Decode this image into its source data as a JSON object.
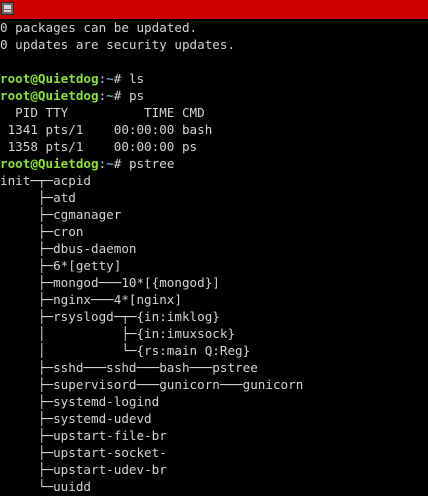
{
  "colors": {
    "titlebar": "#cc0000",
    "background": "#000000",
    "text": "#d3d3d3",
    "prompt_user": "#8ae234",
    "prompt_path": "#729fcf"
  },
  "icons": {
    "window": "terminal-window-icon"
  },
  "motd": [
    "0 packages can be updated.",
    "0 updates are security updates."
  ],
  "prompt": {
    "user_host": "root@Quietdog",
    "colon": ":",
    "path": "~",
    "symbol": "# "
  },
  "commands": {
    "ls": "ls",
    "ps": "ps",
    "pstree": "pstree"
  },
  "ps_output": [
    "  PID TTY          TIME CMD",
    " 1341 pts/1    00:00:00 bash",
    " 1358 pts/1    00:00:00 ps"
  ],
  "pstree_output": [
    "init─┬─acpid",
    "     ├─atd",
    "     ├─cgmanager",
    "     ├─cron",
    "     ├─dbus-daemon",
    "     ├─6*[getty]",
    "     ├─mongod───10*[{mongod}]",
    "     ├─nginx───4*[nginx]",
    "     ├─rsyslogd─┬─{in:imklog}",
    "     │          ├─{in:imuxsock}",
    "     │          └─{rs:main Q:Reg}",
    "     ├─sshd───sshd───bash───pstree",
    "     ├─supervisord───gunicorn───gunicorn",
    "     ├─systemd-logind",
    "     ├─systemd-udevd",
    "     ├─upstart-file-br",
    "     ├─upstart-socket-",
    "     ├─upstart-udev-br",
    "     └─uuidd"
  ]
}
